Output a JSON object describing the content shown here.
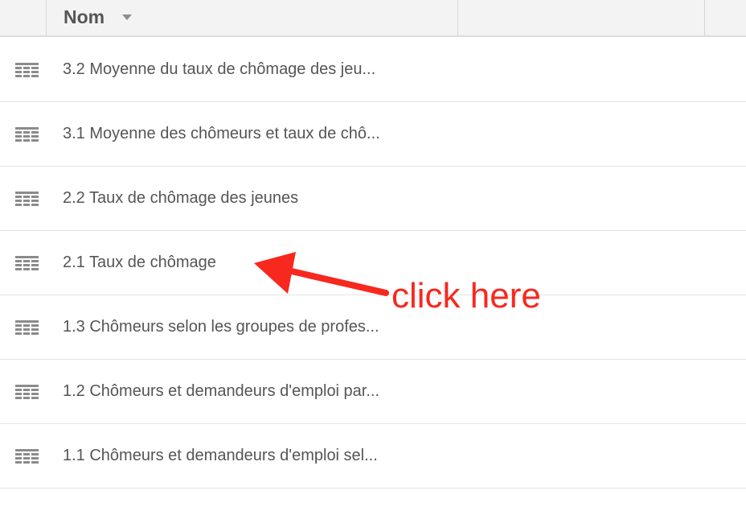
{
  "table": {
    "header": {
      "name_label": "Nom",
      "sort_icon": "caret-down-icon"
    },
    "rows": [
      {
        "icon": "table-icon",
        "label": "3.2 Moyenne du taux de chômage des jeu..."
      },
      {
        "icon": "table-icon",
        "label": "3.1 Moyenne des chômeurs et taux de chô..."
      },
      {
        "icon": "table-icon",
        "label": "2.2 Taux de chômage des jeunes"
      },
      {
        "icon": "table-icon",
        "label": "2.1 Taux de chômage"
      },
      {
        "icon": "table-icon",
        "label": "1.3 Chômeurs selon les groupes de profes..."
      },
      {
        "icon": "table-icon",
        "label": "1.2 Chômeurs et demandeurs d'emploi par..."
      },
      {
        "icon": "table-icon",
        "label": "1.1 Chômeurs et demandeurs d'emploi sel..."
      }
    ]
  },
  "annotation": {
    "text": "click here",
    "color": "#f7281e",
    "icon": "arrow-icon"
  }
}
